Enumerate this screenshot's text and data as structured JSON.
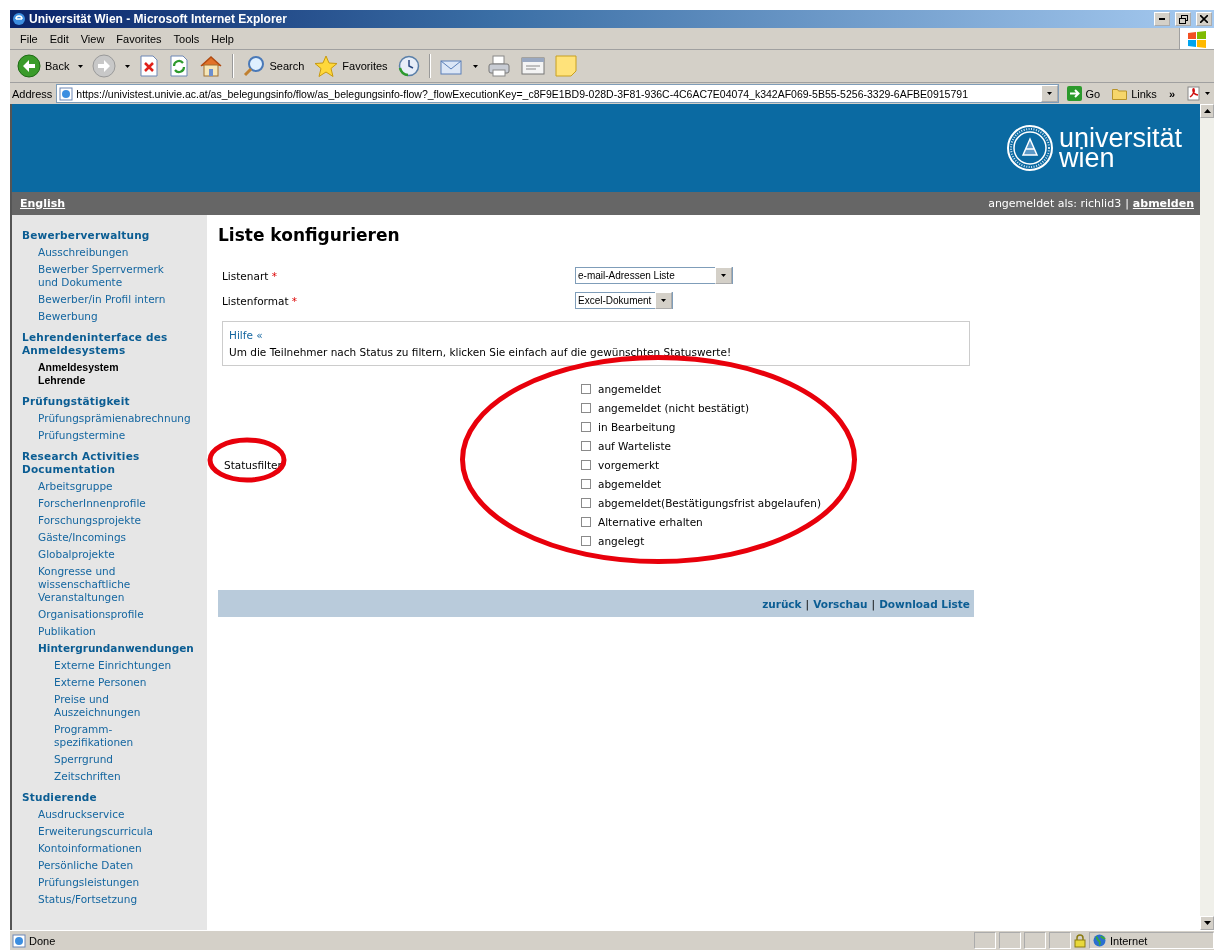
{
  "window": {
    "title": "Universität Wien - Microsoft Internet Explorer"
  },
  "menu": [
    "File",
    "Edit",
    "View",
    "Favorites",
    "Tools",
    "Help"
  ],
  "toolbar": [
    {
      "kind": "back",
      "label": "Back"
    },
    {
      "kind": "forward"
    },
    {
      "kind": "stop"
    },
    {
      "kind": "refresh"
    },
    {
      "kind": "home"
    },
    {
      "kind": "search",
      "label": "Search"
    },
    {
      "kind": "favorites",
      "label": "Favorites"
    },
    {
      "kind": "history"
    },
    {
      "kind": "mail"
    },
    {
      "kind": "print"
    },
    {
      "kind": "edit"
    },
    {
      "kind": "note"
    }
  ],
  "address_bar": {
    "label": "Address",
    "value": "https://univistest.univie.ac.at/as_belegungsinfo/flow/as_belegungsinfo-flow?_flowExecutionKey=_c8F9E1BD9-028D-3F81-936C-4C6AC7E04074_k342AF069-5B55-5256-3329-6AFBE0915791",
    "go": "Go",
    "links": "Links",
    "more": "»"
  },
  "header": {
    "logo": [
      "universität",
      "wien"
    ]
  },
  "top_bar": {
    "language": "English",
    "login": [
      {
        "kind": "text",
        "label": "angemeldet als: richlid3"
      },
      {
        "kind": "separator",
        "label": "|"
      },
      {
        "kind": "link",
        "label": "abmelden"
      }
    ]
  },
  "sidebar": [
    {
      "label": "Bewerberverwaltung",
      "children": [
        {
          "label": "Ausschreibungen",
          "selected": false
        },
        {
          "label": "Bewerber Sperrvermerk\nund Dokumente",
          "selected": false
        },
        {
          "label": "Bewerber/in Profil intern",
          "selected": false
        },
        {
          "label": "Bewerbung",
          "selected": false
        }
      ]
    },
    {
      "label": "Lehrendeninterface des\nAnmeldesystems",
      "children": [
        {
          "label": "Anmeldesystem\nLehrende",
          "selected": true
        }
      ]
    },
    {
      "label": "Prüfungstätigkeit",
      "children": [
        {
          "label": "Prüfungsprämienabrechnung",
          "selected": false
        },
        {
          "label": "Prüfungstermine",
          "selected": false
        }
      ]
    },
    {
      "label": "Research Activities\nDocumentation",
      "children": [
        {
          "label": "Arbeitsgruppe",
          "selected": false
        },
        {
          "label": "ForscherInnenprofile",
          "selected": false
        },
        {
          "label": "Forschungsprojekte",
          "selected": false
        },
        {
          "label": "Gäste/Incomings",
          "selected": false
        },
        {
          "label": "Globalprojekte",
          "selected": false
        },
        {
          "label": "Kongresse und\nwissenschaftliche\nVeranstaltungen",
          "selected": false
        },
        {
          "label": "Organisationsprofile",
          "selected": false
        },
        {
          "label": "Publikation",
          "selected": false
        },
        {
          "label": "Hintergrundanwendungen",
          "selected": false,
          "children": [
            {
              "label": "Externe Einrichtungen",
              "selected": false
            },
            {
              "label": "Externe Personen",
              "selected": false
            },
            {
              "label": "Preise und\nAuszeichnungen",
              "selected": false
            },
            {
              "label": "Programm-\nspezifikationen",
              "selected": false
            },
            {
              "label": "Sperrgrund",
              "selected": false
            },
            {
              "label": "Zeitschriften",
              "selected": false
            }
          ]
        }
      ]
    },
    {
      "label": "Studierende",
      "children": [
        {
          "label": "Ausdruckservice",
          "selected": false
        },
        {
          "label": "Erweiterungscurricula",
          "selected": false
        },
        {
          "label": "Kontoinformationen",
          "selected": false
        },
        {
          "label": "Persönliche Daten",
          "selected": false
        },
        {
          "label": "Prüfungsleistungen",
          "selected": false
        },
        {
          "label": "Status/Fortsetzung",
          "selected": false
        }
      ]
    }
  ],
  "form": {
    "title": "Liste konfigurieren",
    "fields": [
      {
        "label": "Listenart",
        "required_mark": "*",
        "value": "e-mail-Adressen Liste"
      },
      {
        "label": "Listenformat",
        "required_mark": "*",
        "value": "Excel-Dokument"
      }
    ],
    "help": {
      "link": "Hilfe «",
      "text": "Um die Teilnehmer nach Status zu filtern, klicken Sie einfach auf die gewünschten Statuswerte!"
    },
    "status_filter": {
      "label": "Statusfilter",
      "options": [
        {
          "label": "angemeldet",
          "checked": false
        },
        {
          "label": "angemeldet (nicht bestätigt)",
          "checked": false
        },
        {
          "label": "in Bearbeitung",
          "checked": false
        },
        {
          "label": "auf Warteliste",
          "checked": false
        },
        {
          "label": "vorgemerkt",
          "checked": false
        },
        {
          "label": "abgemeldet",
          "checked": false
        },
        {
          "label": "abgemeldet(Bestätigungsfrist abgelaufen)",
          "checked": false
        },
        {
          "label": "Alternative erhalten",
          "checked": false
        },
        {
          "label": "angelegt",
          "checked": false
        }
      ]
    },
    "footer_links": [
      {
        "kind": "link",
        "label": "zurück"
      },
      {
        "kind": "separator",
        "label": "|"
      },
      {
        "kind": "link",
        "label": "Vorschau"
      },
      {
        "kind": "separator",
        "label": "|"
      },
      {
        "kind": "link",
        "label": "Download Liste"
      }
    ]
  },
  "status_bar": {
    "text": "Done",
    "zone": "Internet"
  }
}
